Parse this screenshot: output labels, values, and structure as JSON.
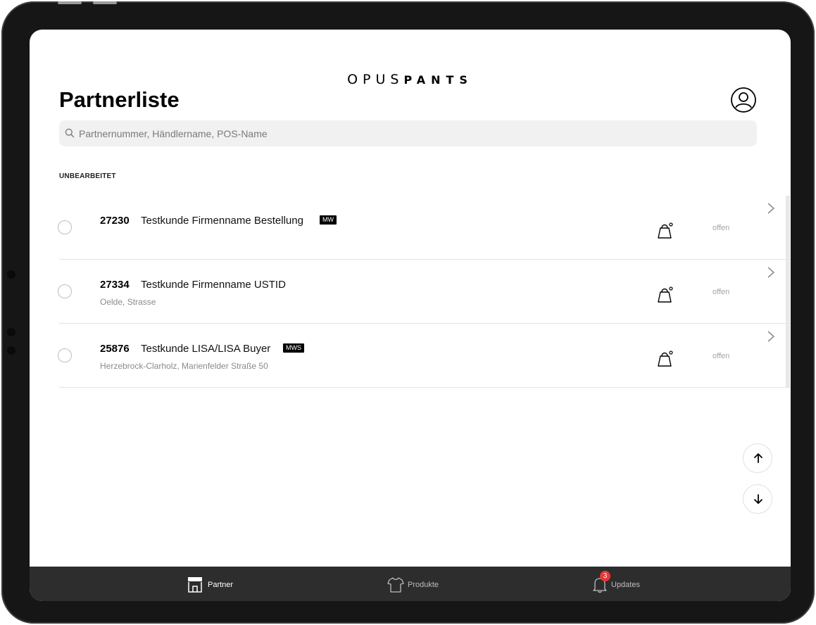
{
  "app": {
    "brand_left": "OPUS",
    "brand_right": "PANTS",
    "title": "Partnerliste"
  },
  "search": {
    "placeholder": "Partnernummer, Händlername, POS-Name"
  },
  "section_label": "UNBEARBEITET",
  "rows": [
    {
      "number": "27230",
      "name": "Testkunde Firmenname Bestellung",
      "badge": "MW",
      "subtitle": "",
      "status": "offen"
    },
    {
      "number": "27334",
      "name": "Testkunde Firmenname USTID",
      "badge": "",
      "subtitle": "Oelde, Strasse",
      "status": "offen"
    },
    {
      "number": "25876",
      "name": "Testkunde LISA/LISA Buyer",
      "badge": "MWS",
      "subtitle": "Herzebrock-Clarholz, Marienfelder Straße 50",
      "status": "offen"
    }
  ],
  "tabs": [
    {
      "label": "Partner",
      "icon": "store-icon",
      "active": true
    },
    {
      "label": "Produkte",
      "icon": "tshirt-icon",
      "active": false
    },
    {
      "label": "Updates",
      "icon": "bell-icon",
      "active": false,
      "badge": "3"
    }
  ],
  "colors": {
    "tabbar_bg": "#2d2d2d",
    "badge_red": "#e53935",
    "accent_black": "#000000",
    "muted_gray": "#8a8a8a"
  }
}
